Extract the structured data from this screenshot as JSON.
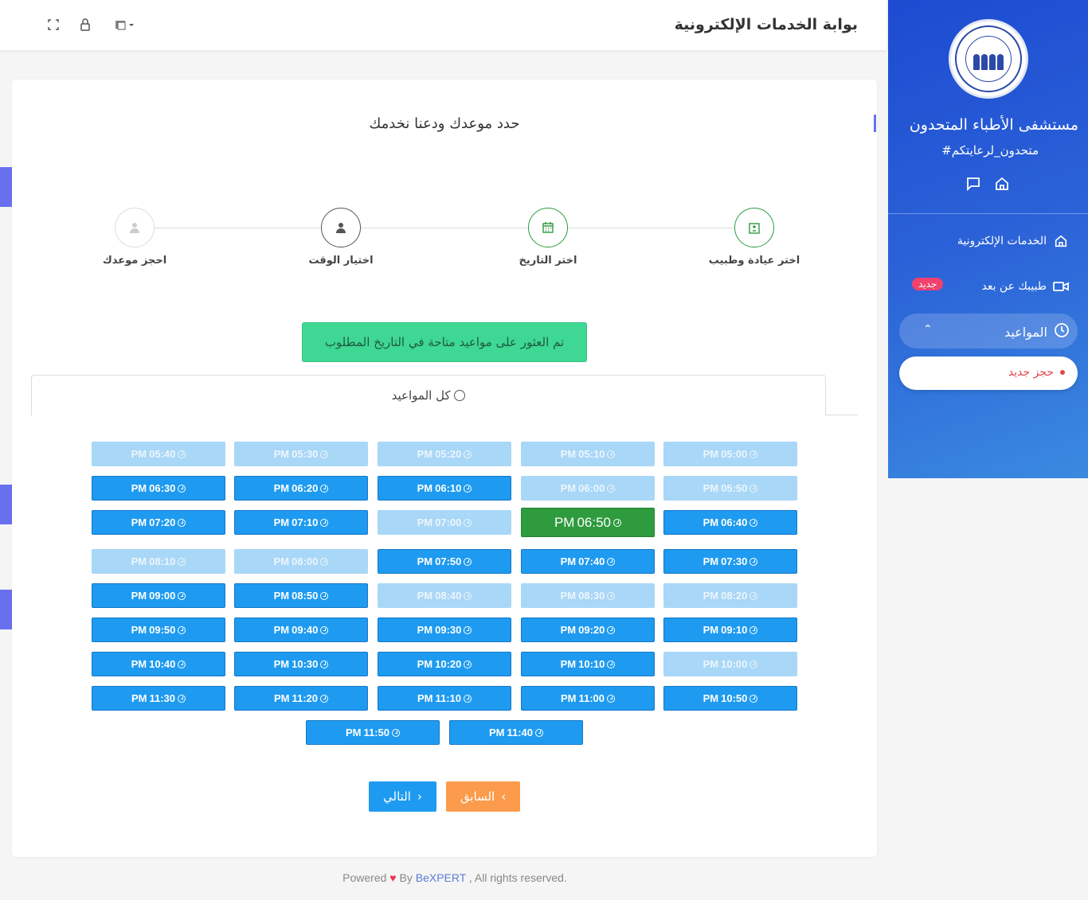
{
  "header": {
    "title": "بوابة الخدمات الإلكترونية"
  },
  "sidebar": {
    "hospital_name": "مستشفى الأطباء المتحدون",
    "hashtag": "#متحدون_لرعايتكم",
    "items": [
      {
        "label": "الخدمات الإلكترونية",
        "icon": "home-icon"
      },
      {
        "label": "طبيبك عن بعد",
        "icon": "video-icon",
        "badge": "جديد"
      },
      {
        "label": "المواعيد",
        "icon": "clock-icon"
      }
    ],
    "sub_item": "حجز جديد"
  },
  "page": {
    "heading": "حدد موعدك ودعنا نخدمك",
    "steps": [
      {
        "label": "اختر عيادة وطبيب",
        "status": "done"
      },
      {
        "label": "اختر التاريخ",
        "status": "done"
      },
      {
        "label": "اختيار الوقت",
        "status": "current"
      },
      {
        "label": "احجز موعدك",
        "status": "pending"
      }
    ],
    "alert": "تم العثور على مواعيد متاحة في التاريخ المطلوب",
    "tab_label": "كل المواعيد"
  },
  "slots": [
    [
      "05:00 PM",
      "05:10 PM",
      "05:20 PM",
      "05:30 PM",
      "05:40 PM"
    ],
    [
      "05:50 PM",
      "06:00 PM",
      "06:10 PM",
      "06:20 PM",
      "06:30 PM"
    ],
    [
      "06:40 PM",
      "06:50 PM",
      "07:00 PM",
      "07:10 PM",
      "07:20 PM"
    ],
    [
      "07:30 PM",
      "07:40 PM",
      "07:50 PM",
      "08:00 PM",
      "08:10 PM"
    ],
    [
      "08:20 PM",
      "08:30 PM",
      "08:40 PM",
      "08:50 PM",
      "09:00 PM"
    ],
    [
      "09:10 PM",
      "09:20 PM",
      "09:30 PM",
      "09:40 PM",
      "09:50 PM"
    ],
    [
      "10:00 PM",
      "10:10 PM",
      "10:20 PM",
      "10:30 PM",
      "10:40 PM"
    ],
    [
      "10:50 PM",
      "11:00 PM",
      "11:10 PM",
      "11:20 PM",
      "11:30 PM"
    ],
    [
      "11:40 PM",
      "11:50 PM"
    ]
  ],
  "slot_states": [
    [
      "dis",
      "dis",
      "dis",
      "dis",
      "dis"
    ],
    [
      "dis",
      "dis",
      "avail",
      "avail",
      "avail"
    ],
    [
      "avail",
      "sel",
      "dis",
      "avail",
      "avail"
    ],
    [
      "avail",
      "avail",
      "avail",
      "dis",
      "dis"
    ],
    [
      "dis",
      "dis",
      "dis",
      "avail",
      "avail"
    ],
    [
      "avail",
      "avail",
      "avail",
      "avail",
      "avail"
    ],
    [
      "dis",
      "avail",
      "avail",
      "avail",
      "avail"
    ],
    [
      "avail",
      "avail",
      "avail",
      "avail",
      "avail"
    ],
    [
      "avail",
      "avail"
    ]
  ],
  "buttons": {
    "next": "التالي",
    "prev": "السابق"
  },
  "footer": {
    "prefix": "Powered",
    "by": "By",
    "brand": "BeXPERT",
    "suffix": ", All rights reserved."
  },
  "colors": {
    "primary": "#1e9bf0",
    "selected": "#2e9b3e",
    "disabled": "#a9d7f7",
    "accent": "#6870f0"
  }
}
